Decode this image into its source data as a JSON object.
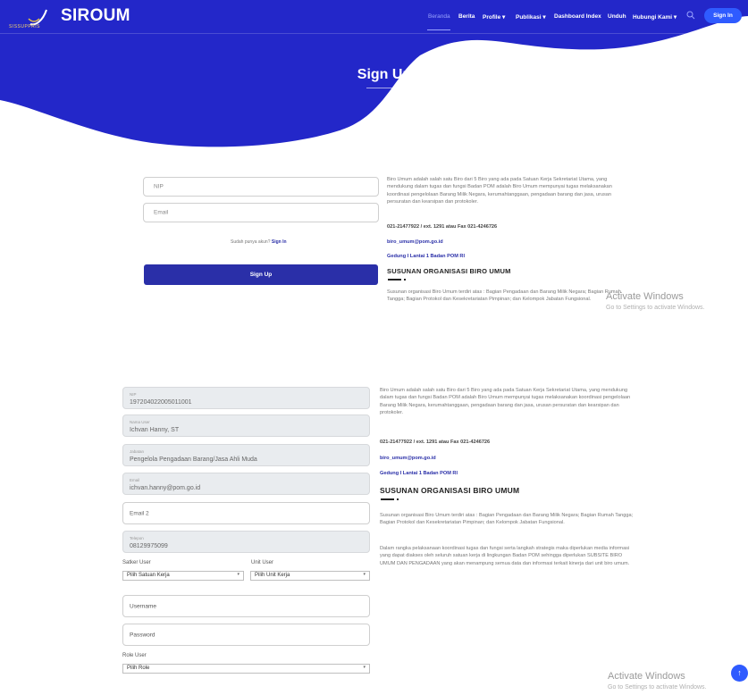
{
  "brand": {
    "name": "SIROUM",
    "tagline": "SISSUPPRIS"
  },
  "nav": {
    "items": [
      "Beranda",
      "Berita",
      "Profile ▾",
      "Publikasi ▾",
      "Dashboard Index",
      "Unduh",
      "Hubungi Kami ▾"
    ],
    "signin": "Sign In"
  },
  "hero": {
    "title": "Sign Up"
  },
  "signup_form": {
    "nip_placeholder": "NIP",
    "email_placeholder": "Email",
    "have_account": "Sudah punya akun?",
    "signin_link": "Sign In",
    "submit": "Sign Up"
  },
  "info_top": {
    "description": "Biro Umum adalah salah satu Biro dari 5 Biro yang ada pada Satuan Kerja Sekretariat Utama, yang mendukung dalam tugas dan fungsi Badan POM adalah Biro Umum mempunyai tugas melaksanakan koordinasi pengelolaan Barang Milik Negara, kerumahtanggaan, pengadaan barang dan jasa, urusan persuratan dan kearsipan dan protokoler.",
    "phone": "021-21477922 / ext. 1291 atau Fax 021-4246726",
    "email": "biro_umum@pom.go.id",
    "address": "Gedung I Lantai 1 Badan POM RI",
    "org_title": "SUSUNAN ORGANISASI BIRO UMUM",
    "org_text": "Susunan organisasi Biro Umum terdiri atas : Bagian Pengadaan dan Barang Milik Negara; Bagian Rumah Tangga; Bagian Protokol dan Kesekretariatan Pimpinan; dan Kelompok Jabatan Fungsional."
  },
  "profile_form": {
    "nip_label": "NIP",
    "nip_value": "197204022005011001",
    "nama_label": "Nama User",
    "nama_value": "Ichvan Hanny, ST",
    "jabatan_label": "Jabatan",
    "jabatan_value": "Pengelola Pengadaan Barang/Jasa Ahli Muda",
    "email_label": "Email",
    "email_value": "ichvan.hanny@pom.go.id",
    "email2_placeholder": "Email 2",
    "telp_label": "Telepon",
    "telp_value": "08129975099",
    "satker_label": "Satker User",
    "satker_value": "Pilih Satuan Kerja",
    "unit_label": "Unit User",
    "unit_value": "Pilih Unit Kerja",
    "username_placeholder": "Username",
    "password_placeholder": "Password",
    "role_label": "Role User",
    "role_value": "Pilih Role"
  },
  "info_bottom": {
    "description": "Biro Umum adalah salah satu Biro dari 5 Biro yang ada pada Satuan Kerja Sekretariat Utama, yang mendukung dalam tugas dan fungsi Badan POM adalah Biro Umum mempunyai tugas melaksanakan koordinasi pengelolaan Barang Milik Negara, kerumahtanggaan, pengadaan barang dan jasa, urusan persuratan dan kearsipan dan protokoler.",
    "phone": "021-21477922 / ext. 1291 atau Fax 021-4246726",
    "email": "biro_umum@pom.go.id",
    "address": "Gedung I Lantai 1 Badan POM RI",
    "org_title": "SUSUNAN ORGANISASI BIRO UMUM",
    "org_text": "Susunan organisasi Biro Umum terdiri atas : Bagian Pengadaan dan Barang Milik Negara; Bagian Rumah Tangga; Bagian Protokol dan Kesekretariatan Pimpinan; dan Kelompok Jabatan Fungsional.",
    "extra_text": "Dalam rangka pelaksanaan koordinasi tugas dan fungsi serta langkah strategis maka diperlukan media informasi yang dapat diakses oleh seluruh satuan kerja di lingkungan Badan POM sehingga diperlukan SUBSITE BIRO UMUM DAN PENGADAAN yang akan menampung semua data dan informasi terkait kinerja dari unit biro umum."
  },
  "watermark": {
    "title": "Activate Windows",
    "subtitle": "Go to Settings to activate Windows."
  },
  "fab_icon": "↑",
  "colors": {
    "primary": "#2a2fa8",
    "hero": "#2327c9",
    "accent": "#2f5bff"
  }
}
